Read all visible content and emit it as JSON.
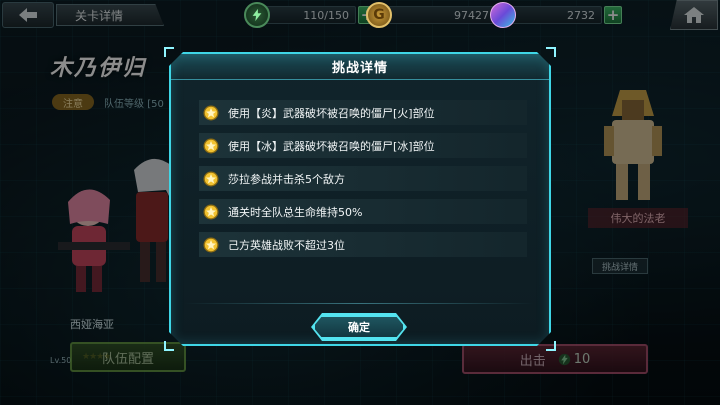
{
  "header": {
    "title": "关卡详情",
    "energy": "110/150",
    "gold": "97427",
    "gems": "2732"
  },
  "stage": {
    "name": "木乃伊归",
    "note_tag": "注意",
    "team_level_label": "队伍等级",
    "team_level_value": "[50"
  },
  "hero": {
    "name": "西娅海亚",
    "level": "Lv.50",
    "stars": "★★★★"
  },
  "enemy": {
    "name": "伟大的法老"
  },
  "challenge_chip": "挑战详情",
  "buttons": {
    "team": "队伍配置",
    "fight": "出击",
    "fight_cost": "10"
  },
  "modal": {
    "title": "挑战详情",
    "objectives": [
      "使用【炎】武器破坏被召唤的僵尸[火]部位",
      "使用【冰】武器破坏被召唤的僵尸[冰]部位",
      "莎拉参战并击杀5个敌方",
      "通关时全队总生命维持50%",
      "己方英雄战败不超过3位"
    ],
    "confirm": "确定"
  },
  "colors": {
    "accent": "#3fd6e6",
    "star": "#f2c230",
    "panel": "#11242b"
  }
}
